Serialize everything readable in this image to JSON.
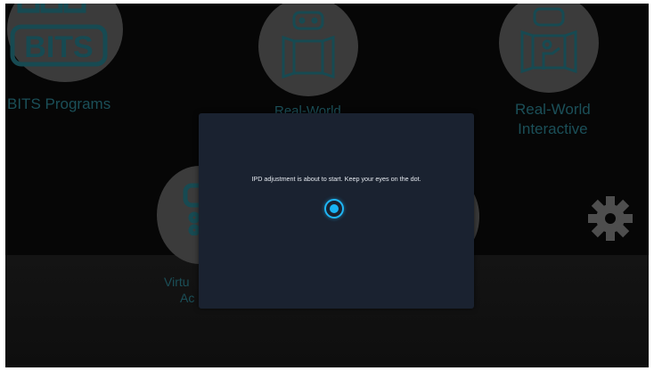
{
  "background": {
    "tiles": [
      {
        "id": "bits",
        "label": "BITS Programs",
        "logo": "BITS"
      },
      {
        "id": "real-world",
        "label": "Real-World"
      },
      {
        "id": "real-world-interactive",
        "label": "Real-World\nInteractive"
      },
      {
        "id": "virtual",
        "label": "Virtu",
        "label2": "Ac"
      }
    ],
    "settings_icon": "gear-icon"
  },
  "dialog": {
    "message": "IPD adjustment is about to start. Keep your eyes on the dot.",
    "dot_icon": "target-dot-icon",
    "accent": "#1fb6f5"
  },
  "colors": {
    "dialog_bg": "#1a2230",
    "label_teal": "#1b4f58",
    "tile_gray": "#3b3b3b"
  }
}
